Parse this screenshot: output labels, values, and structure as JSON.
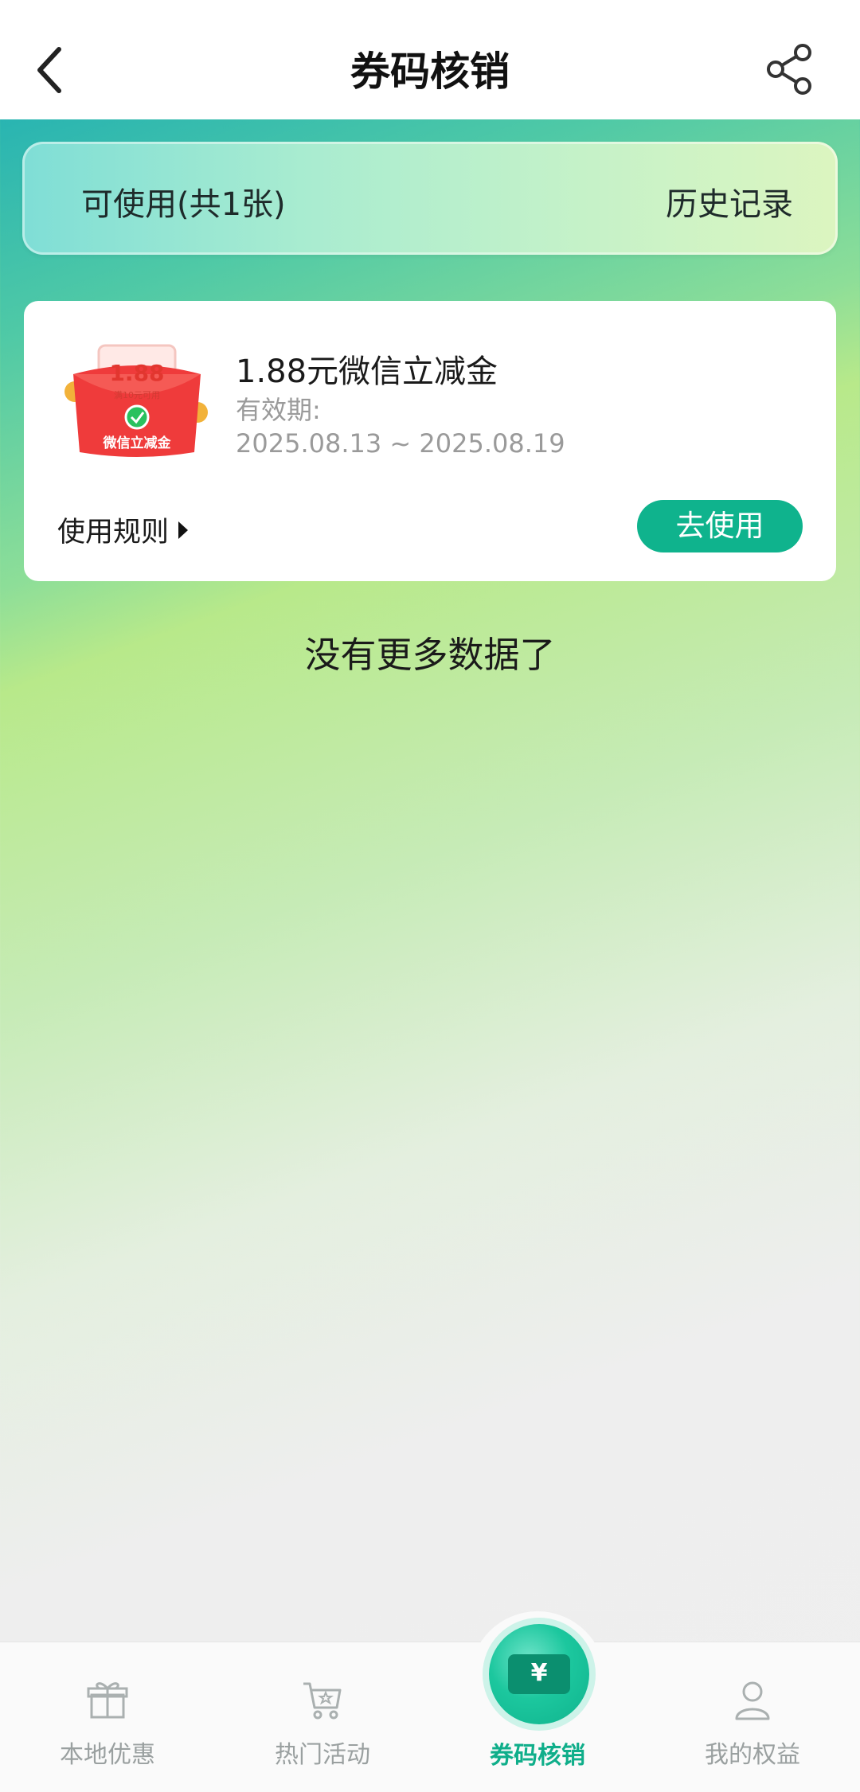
{
  "header": {
    "title": "券码核销",
    "back_icon": "chevron-left-icon",
    "share_icon": "share-icon"
  },
  "tabs": {
    "available": "可使用(共1张)",
    "history": "历史记录"
  },
  "coupon": {
    "image_amount": "1.88",
    "image_condition": "满10元可用",
    "image_label": "微信立减金",
    "name": "1.88元微信立减金",
    "validity_label": "有效期:",
    "validity_range": "2025.08.13 ~ 2025.08.19",
    "rules_label": "使用规则",
    "use_button": "去使用"
  },
  "list_end_text": "没有更多数据了",
  "bottom_nav": {
    "items": [
      {
        "label": "本地优惠",
        "icon": "gift-icon"
      },
      {
        "label": "热门活动",
        "icon": "cart-icon"
      },
      {
        "label": "券码核销",
        "icon": "ticket-icon",
        "active": true
      },
      {
        "label": "我的权益",
        "icon": "user-icon"
      }
    ],
    "active_color": "#0fae8a",
    "inactive_color": "#9aa0a0"
  },
  "colors": {
    "accent": "#0fb38d"
  }
}
